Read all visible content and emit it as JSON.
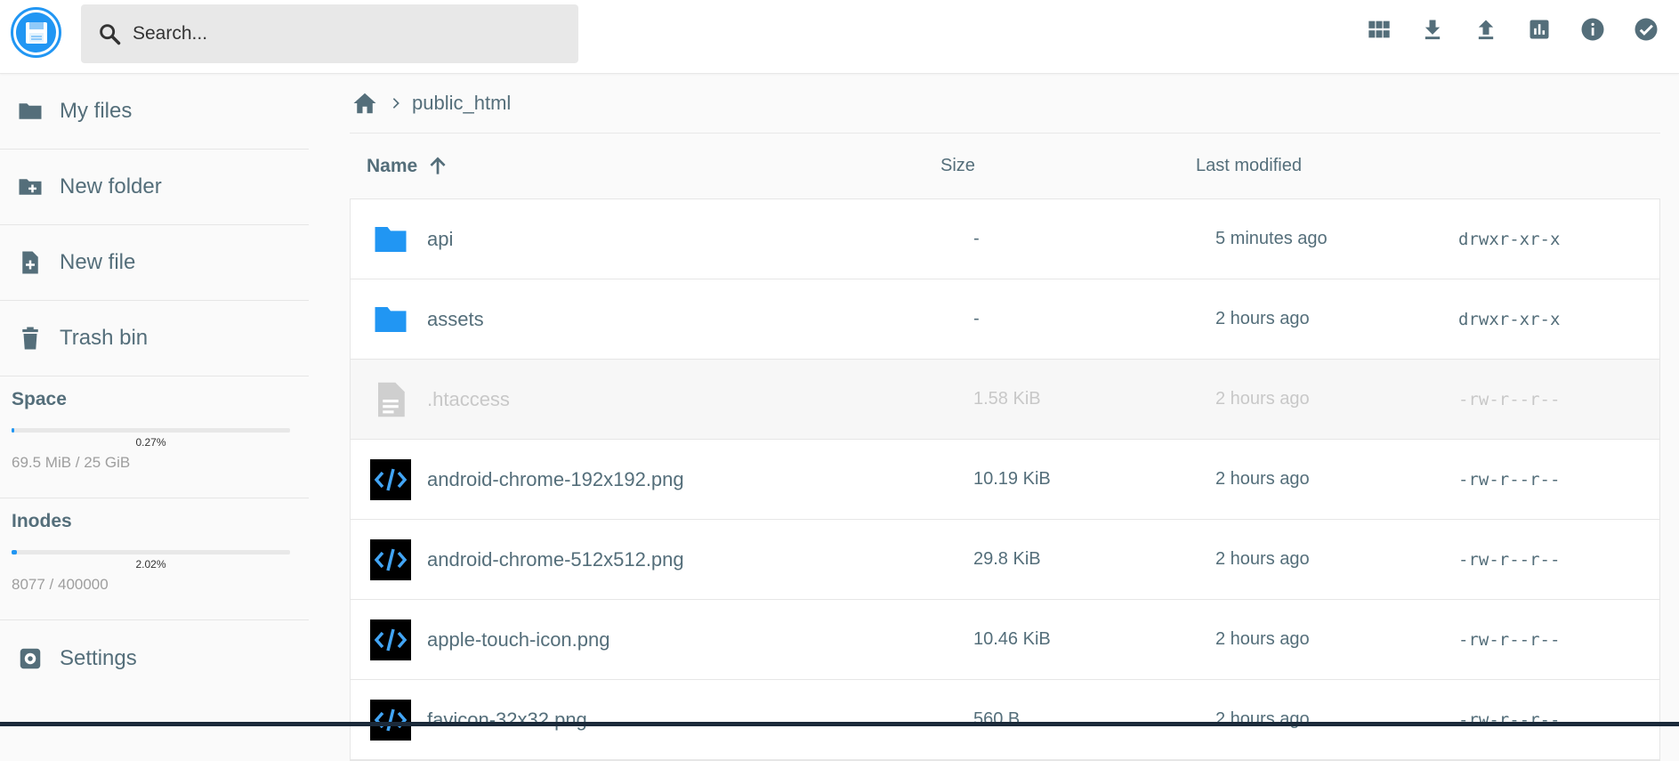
{
  "search": {
    "placeholder": "Search..."
  },
  "toolbar": {
    "actions": [
      "view-mode",
      "download",
      "upload",
      "stats",
      "info",
      "select"
    ]
  },
  "sidebar": {
    "items": [
      {
        "label": "My files",
        "icon": "folder-icon"
      },
      {
        "label": "New folder",
        "icon": "create-folder-icon"
      },
      {
        "label": "New file",
        "icon": "new-file-icon"
      },
      {
        "label": "Trash bin",
        "icon": "trash-icon"
      }
    ],
    "space": {
      "title": "Space",
      "percent": "0.27%",
      "fraction": 0.0027,
      "text": "69.5 MiB / 25 GiB"
    },
    "inodes": {
      "title": "Inodes",
      "percent": "2.02%",
      "fraction": 0.0202,
      "text": "8077 / 400000"
    },
    "settings": {
      "label": "Settings",
      "icon": "gear-icon"
    }
  },
  "breadcrumb": {
    "path": "public_html"
  },
  "columns": {
    "name": "Name",
    "size": "Size",
    "modified": "Last modified"
  },
  "files": [
    {
      "name": "api",
      "size": "-",
      "modified": "5 minutes ago",
      "perm": "drwxr-xr-x",
      "type": "folder"
    },
    {
      "name": "assets",
      "size": "-",
      "modified": "2 hours ago",
      "perm": "drwxr-xr-x",
      "type": "folder"
    },
    {
      "name": ".htaccess",
      "size": "1.58 KiB",
      "modified": "2 hours ago",
      "perm": "-rw-r--r--",
      "type": "hidden"
    },
    {
      "name": "android-chrome-192x192.png",
      "size": "10.19 KiB",
      "modified": "2 hours ago",
      "perm": "-rw-r--r--",
      "type": "code"
    },
    {
      "name": "android-chrome-512x512.png",
      "size": "29.8 KiB",
      "modified": "2 hours ago",
      "perm": "-rw-r--r--",
      "type": "code"
    },
    {
      "name": "apple-touch-icon.png",
      "size": "10.46 KiB",
      "modified": "2 hours ago",
      "perm": "-rw-r--r--",
      "type": "code"
    },
    {
      "name": "favicon-32x32.png",
      "size": "560 B",
      "modified": "2 hours ago",
      "perm": "-rw-r--r--",
      "type": "code"
    }
  ],
  "colors": {
    "accent": "#2196f3",
    "text": "#546e7a",
    "muted": "#9e9e9e"
  }
}
